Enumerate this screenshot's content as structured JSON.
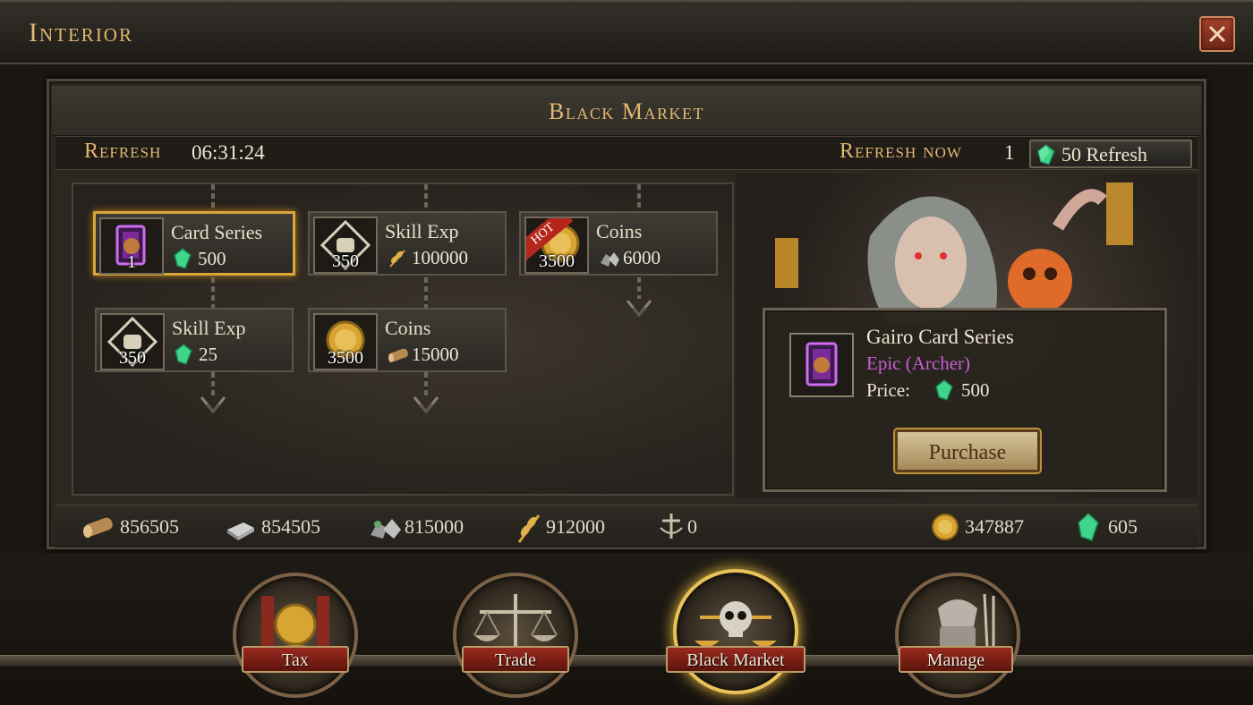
{
  "window": {
    "title": "Interior",
    "close_icon": "close-icon"
  },
  "panel": {
    "title": "Black Market",
    "refresh_label": "Refresh",
    "refresh_timer": "06:31:24",
    "refresh_now_label": "Refresh now",
    "refresh_now_count": "1",
    "refresh_button_label": "50 Refresh"
  },
  "items": [
    {
      "name": "Card Series",
      "count": "1",
      "price": "500",
      "price_icon": "gem-icon",
      "icon": "card-icon",
      "selected": true,
      "hot": false
    },
    {
      "name": "Skill Exp",
      "count": "350",
      "price": "100000",
      "price_icon": "wheat-icon",
      "icon": "skill-exp-icon",
      "selected": false,
      "hot": false
    },
    {
      "name": "Coins",
      "count": "3500",
      "price": "6000",
      "price_icon": "stone-icon",
      "icon": "coin-icon",
      "selected": false,
      "hot": true,
      "hot_label": "HOT"
    },
    {
      "name": "Skill Exp",
      "count": "350",
      "price": "25",
      "price_icon": "gem-icon",
      "icon": "skill-exp-icon",
      "selected": false,
      "hot": false
    },
    {
      "name": "Coins",
      "count": "3500",
      "price": "15000",
      "price_icon": "wood-icon",
      "icon": "coin-icon",
      "selected": false,
      "hot": false
    }
  ],
  "detail": {
    "name": "Gairo Card Series",
    "rarity": "Epic (Archer)",
    "price_label": "Price:",
    "price_value": "500",
    "purchase_label": "Purchase"
  },
  "resources": {
    "wood": "856505",
    "iron": "854505",
    "stone": "815000",
    "wheat": "912000",
    "troops": "0",
    "gold": "347887",
    "gems": "605"
  },
  "nav": [
    {
      "label": "Tax",
      "icon": "tax-icon",
      "active": false
    },
    {
      "label": "Trade",
      "icon": "trade-scales-icon",
      "active": false
    },
    {
      "label": "Black Market",
      "icon": "black-market-skull-icon",
      "active": true
    },
    {
      "label": "Manage",
      "icon": "manage-armor-icon",
      "active": false
    }
  ],
  "colors": {
    "accent": "#e2b870",
    "selected_border": "#d9a53a",
    "epic": "#c85ed4",
    "gem": "#3fd68a",
    "nav_label": "#9a2a1f"
  }
}
